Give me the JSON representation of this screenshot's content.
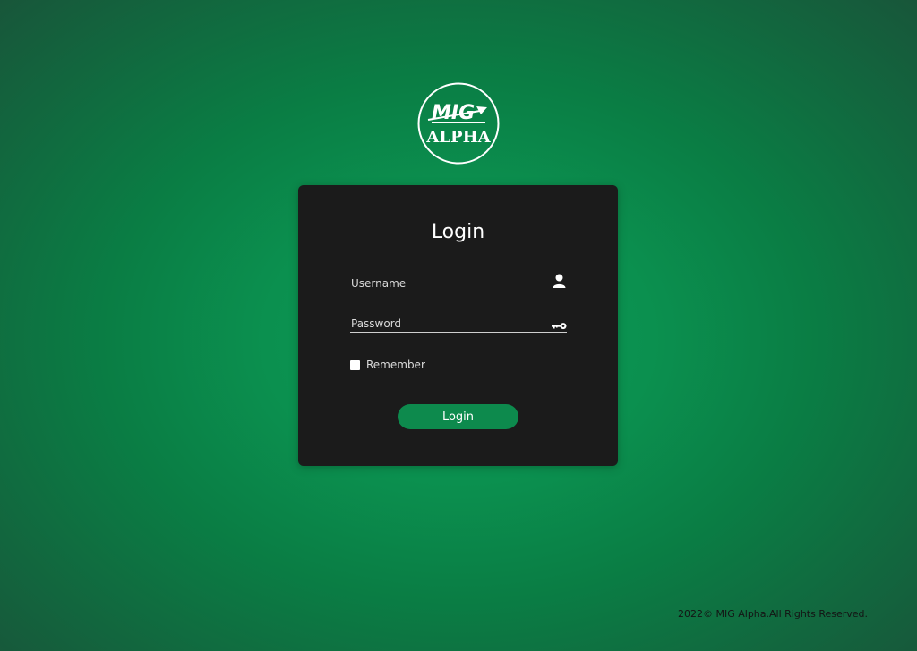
{
  "logo": {
    "line1": "MIG",
    "line2": "ALPHA"
  },
  "login_card": {
    "title": "Login",
    "username": {
      "value": "",
      "placeholder": "Username",
      "icon": "user-icon"
    },
    "password": {
      "value": "",
      "placeholder": "Password",
      "icon": "key-icon"
    },
    "remember": {
      "label": "Remember",
      "checked": false
    },
    "submit_label": "Login"
  },
  "footer": {
    "text": "2022© MIG Alpha.All Rights Reserved."
  },
  "colors": {
    "background_center": "#0c9a55",
    "background_edge": "#18563a",
    "card": "#1b1b1b",
    "button": "#0d8a4d",
    "text": "#ffffff"
  }
}
